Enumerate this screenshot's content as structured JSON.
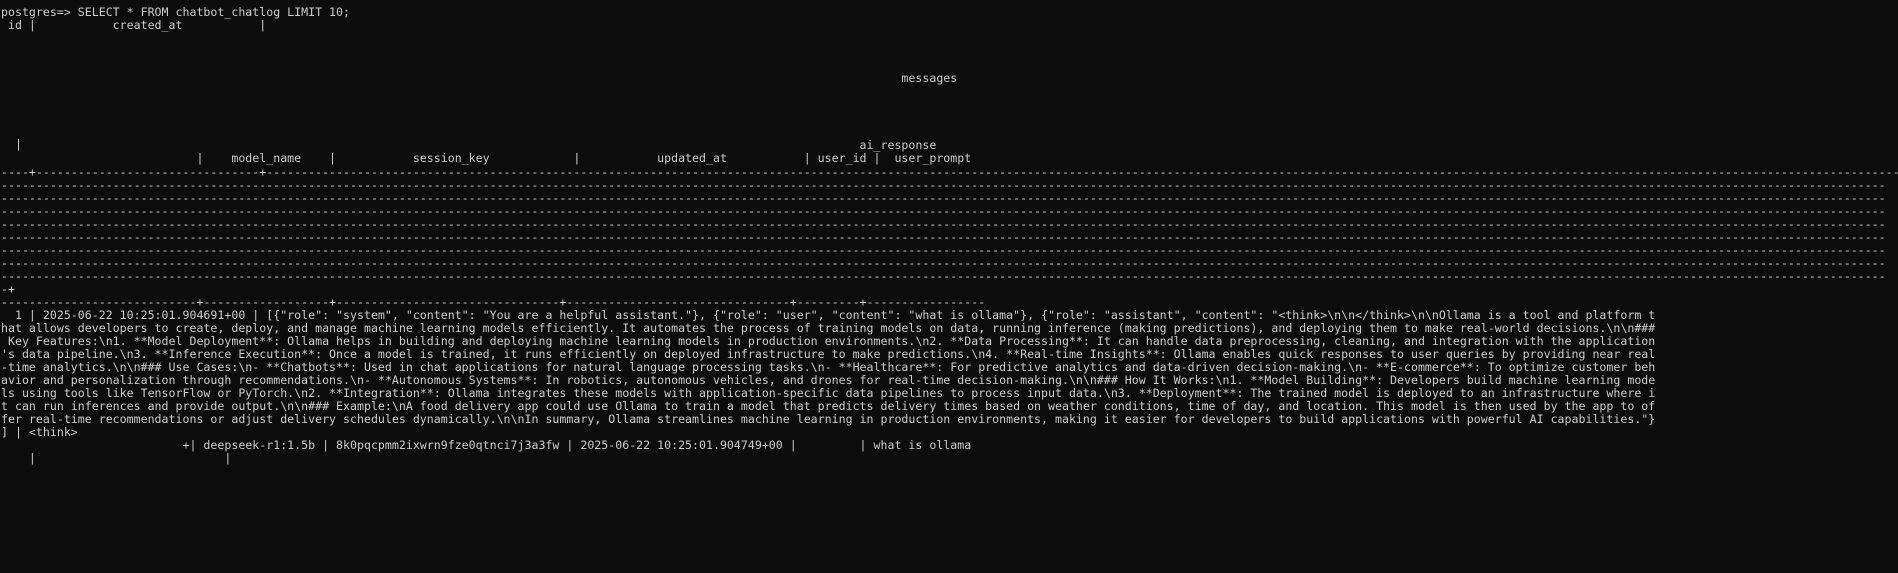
{
  "terminal": {
    "prompt_command": "postgres=> SELECT * FROM chatbot_chatlog LIMIT 10;",
    "header_line_1": " id |           created_at           |",
    "header_messages": "                                                                                                                                 messages",
    "header_pipe": "  |",
    "header_ai_response": "                                                                                                                           ai_response",
    "header_line_2": "                            |    model_name    |           session_key            |           updated_at           | user_id |  user_prompt",
    "separator_first": "----+--------------------------------+----------------------------------------------------------------------------------------------------------------------------------------------------------------------------------------------------------------------------------------------------",
    "separator_dashes": "------------------------------------------------------------------------------------------------------------------------------------------------------------------------------------------------------------------------------------------------------------------------------",
    "separator_plus": "-+",
    "separator_last": "----------------------------+------------------+--------------------------------+--------------------------------+---------+-----------------",
    "row_lines": [
      "  1 | 2025-06-22 10:25:01.904691+00 | [{\"role\": \"system\", \"content\": \"You are a helpful assistant.\"}, {\"role\": \"user\", \"content\": \"what is ollama\"}, {\"role\": \"assistant\", \"content\": \"<think>\\n\\n</think>\\n\\nOllama is a tool and platform t",
      "hat allows developers to create, deploy, and manage machine learning models efficiently. It automates the process of training models on data, running inference (making predictions), and deploying them to make real-world decisions.\\n\\n###",
      " Key Features:\\n1. **Model Deployment**: Ollama helps in building and deploying machine learning models in production environments.\\n2. **Data Processing**: It can handle data preprocessing, cleaning, and integration with the application",
      "'s data pipeline.\\n3. **Inference Execution**: Once a model is trained, it runs efficiently on deployed infrastructure to make predictions.\\n4. **Real-time Insights**: Ollama enables quick responses to user queries by providing near real",
      "-time analytics.\\n\\n### Use Cases:\\n- **Chatbots**: Used in chat applications for natural language processing tasks.\\n- **Healthcare**: For predictive analytics and data-driven decision-making.\\n- **E-commerce**: To optimize customer beh",
      "avior and personalization through recommendations.\\n- **Autonomous Systems**: In robotics, autonomous vehicles, and drones for real-time decision-making.\\n\\n### How It Works:\\n1. **Model Building**: Developers build machine learning mode",
      "ls using tools like TensorFlow or PyTorch.\\n2. **Integration**: Ollama integrates these models with application-specific data pipelines to process input data.\\n3. **Deployment**: The trained model is deployed to an infrastructure where i",
      "t can run inferences and provide output.\\n\\n### Example:\\nA food delivery app could use Ollama to train a model that predicts delivery times based on weather conditions, time of day, and location. This model is then used by the app to of",
      "fer real-time recommendations or adjust delivery schedules dynamically.\\n\\nIn summary, Ollama streamlines machine learning in production environments, making it easier for developers to build applications with powerful AI capabilities.\"}",
      "] | <think>",
      "                          +| deepseek-r1:1.5b | 8k0pqcpmm2ixwrn9fze0qtnci7j3a3fw | 2025-06-22 10:25:01.904749+00 |         | what is ollama",
      "    |                           |"
    ]
  }
}
